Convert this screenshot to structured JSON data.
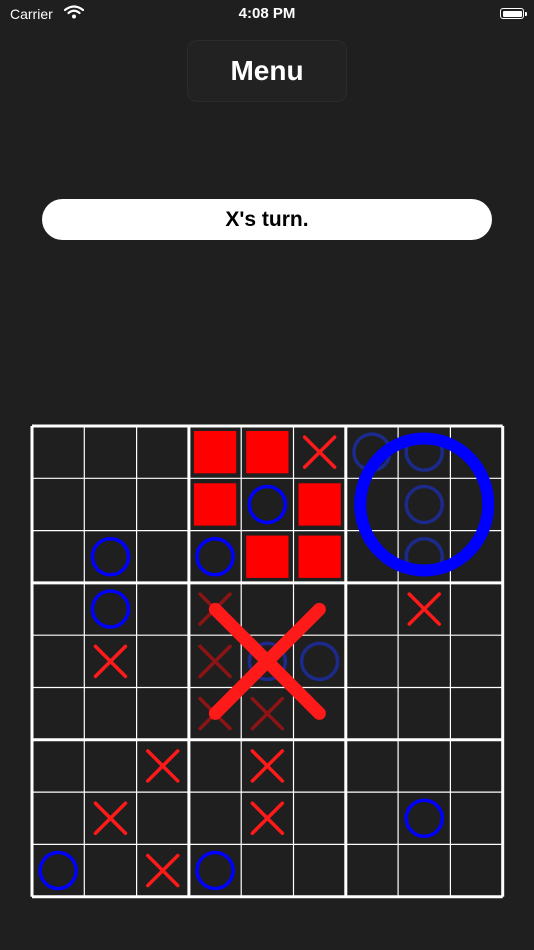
{
  "status_bar": {
    "carrier": "Carrier",
    "time": "4:08 PM"
  },
  "menu": {
    "label": "Menu"
  },
  "status": {
    "turn_text": "X's turn."
  },
  "colors": {
    "background": "#1f1f1f",
    "grid": "#ffffff",
    "x_mark": "#ff1a1a",
    "x_mark_dim": "#8c1414",
    "o_mark": "#0000ff",
    "o_mark_dim": "#1c2a8c",
    "captured_square": "#ff0000"
  },
  "board": {
    "cells": [
      [
        {
          "m": ""
        },
        {
          "m": ""
        },
        {
          "m": ""
        },
        {
          "m": "sq"
        },
        {
          "m": "sq"
        },
        {
          "m": "X"
        },
        {
          "m": "O",
          "dim": true
        },
        {
          "m": "O",
          "dim": true
        },
        {
          "m": ""
        }
      ],
      [
        {
          "m": ""
        },
        {
          "m": ""
        },
        {
          "m": ""
        },
        {
          "m": "sq"
        },
        {
          "m": "O"
        },
        {
          "m": "sq"
        },
        {
          "m": ""
        },
        {
          "m": "O",
          "dim": true
        },
        {
          "m": ""
        }
      ],
      [
        {
          "m": ""
        },
        {
          "m": "O"
        },
        {
          "m": ""
        },
        {
          "m": "O"
        },
        {
          "m": "sq"
        },
        {
          "m": "sq"
        },
        {
          "m": ""
        },
        {
          "m": "O",
          "dim": true
        },
        {
          "m": ""
        }
      ],
      [
        {
          "m": ""
        },
        {
          "m": "O"
        },
        {
          "m": ""
        },
        {
          "m": "X",
          "dim": true
        },
        {
          "m": ""
        },
        {
          "m": ""
        },
        {
          "m": ""
        },
        {
          "m": "X"
        },
        {
          "m": ""
        }
      ],
      [
        {
          "m": ""
        },
        {
          "m": "X"
        },
        {
          "m": ""
        },
        {
          "m": "X",
          "dim": true
        },
        {
          "m": "O",
          "dim": true
        },
        {
          "m": "O",
          "dim": true
        },
        {
          "m": ""
        },
        {
          "m": ""
        },
        {
          "m": ""
        }
      ],
      [
        {
          "m": ""
        },
        {
          "m": ""
        },
        {
          "m": ""
        },
        {
          "m": "X",
          "dim": true
        },
        {
          "m": "X",
          "dim": true
        },
        {
          "m": ""
        },
        {
          "m": ""
        },
        {
          "m": ""
        },
        {
          "m": ""
        }
      ],
      [
        {
          "m": ""
        },
        {
          "m": ""
        },
        {
          "m": "X"
        },
        {
          "m": ""
        },
        {
          "m": "X"
        },
        {
          "m": ""
        },
        {
          "m": ""
        },
        {
          "m": ""
        },
        {
          "m": ""
        }
      ],
      [
        {
          "m": ""
        },
        {
          "m": "X"
        },
        {
          "m": ""
        },
        {
          "m": ""
        },
        {
          "m": "X"
        },
        {
          "m": ""
        },
        {
          "m": ""
        },
        {
          "m": "O"
        },
        {
          "m": ""
        }
      ],
      [
        {
          "m": "O"
        },
        {
          "m": ""
        },
        {
          "m": "X"
        },
        {
          "m": "O"
        },
        {
          "m": ""
        },
        {
          "m": ""
        },
        {
          "m": ""
        },
        {
          "m": ""
        },
        {
          "m": ""
        }
      ]
    ],
    "big_marks": [
      {
        "sub_row": 0,
        "sub_col": 2,
        "mark": "O"
      },
      {
        "sub_row": 1,
        "sub_col": 1,
        "mark": "X"
      }
    ]
  }
}
